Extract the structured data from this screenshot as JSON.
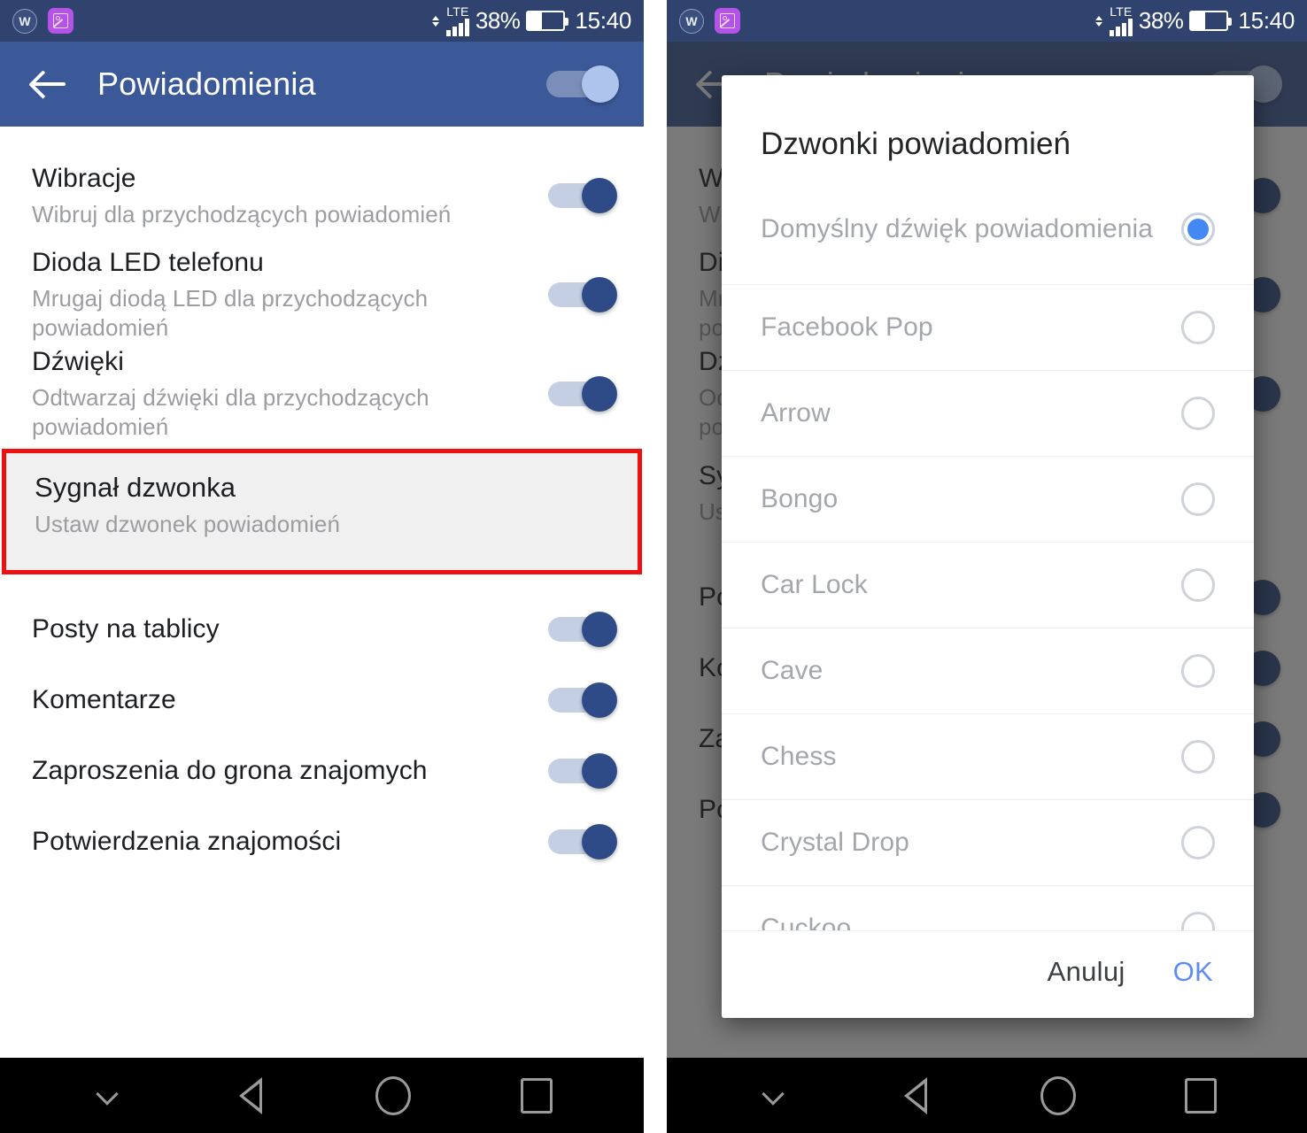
{
  "status_bar": {
    "icons": [
      "workplace-icon",
      "screenshot-icon"
    ],
    "network_type": "LTE",
    "battery_percent": "38%",
    "clock": "15:40"
  },
  "app_bar": {
    "back_label": "back-arrow",
    "title": "Powiadomienia",
    "master_switch_on": true
  },
  "settings": {
    "rows": [
      {
        "title": "Wibracje",
        "sub": "Wibruj dla przychodzących powiadomień",
        "switch": true
      },
      {
        "title": "Dioda LED telefonu",
        "sub": "Mrugaj diodą LED dla przychodzących powiadomień",
        "switch": true
      },
      {
        "title": "Dźwięki",
        "sub": "Odtwarzaj dźwięki dla przychodzących powiadomień",
        "switch": true
      },
      {
        "title": "Sygnał dzwonka",
        "sub": "Ustaw dzwonek powiadomień",
        "switch": false,
        "highlighted": true
      },
      {
        "title": "Posty na tablicy",
        "sub": "",
        "switch": true
      },
      {
        "title": "Komentarze",
        "sub": "",
        "switch": true
      },
      {
        "title": "Zaproszenia do grona znajomych",
        "sub": "",
        "switch": true
      },
      {
        "title": "Potwierdzenia znajomości",
        "sub": "",
        "switch": true
      }
    ]
  },
  "dialog": {
    "title": "Dzwonki powiadomień",
    "items": [
      {
        "label": "Domyślny dźwięk powiadomienia",
        "selected": true,
        "two_line": true
      },
      {
        "label": "Facebook Pop",
        "selected": false
      },
      {
        "label": "Arrow",
        "selected": false
      },
      {
        "label": "Bongo",
        "selected": false
      },
      {
        "label": "Car Lock",
        "selected": false
      },
      {
        "label": "Cave",
        "selected": false
      },
      {
        "label": "Chess",
        "selected": false
      },
      {
        "label": "Crystal Drop",
        "selected": false
      },
      {
        "label": "Cuckoo",
        "selected": false
      }
    ],
    "cancel_label": "Anuluj",
    "ok_label": "OK"
  },
  "nav_bar": {
    "buttons": [
      "chevron-down-icon",
      "back-icon",
      "home-icon",
      "recents-icon"
    ]
  },
  "colors": {
    "status_bar": "#30436f",
    "app_bar": "#3b5998",
    "switch_thumb_on": "#2e4a87",
    "switch_track_on": "#c4cfe4",
    "highlight_border": "#ee1111",
    "highlight_bg": "#f0f0f0",
    "radio_selected": "#4488f4",
    "ok_button": "#5e8df0"
  }
}
